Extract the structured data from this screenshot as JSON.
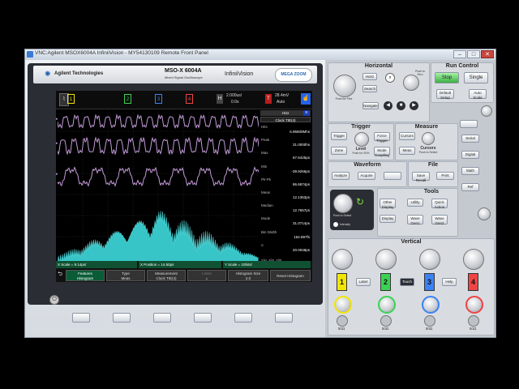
{
  "window": {
    "title": "VNC:Agilent MSOX6004A InfiniiVision - MY54130109 Remote Front Panel"
  },
  "brand": {
    "company": "Agilent Technologies",
    "model": "MSO-X 6004A",
    "model_sub": "Mixed Signal Oscilloscope",
    "series": "InfiniiVision",
    "mega": "MEGA ZOOM"
  },
  "screen": {
    "channels": [
      "1",
      "2",
      "3",
      "4"
    ],
    "channel_colors": [
      "#f2e600",
      "#39d353",
      "#3b82f6",
      "#ef4444"
    ],
    "timebase": {
      "scale": "2.000us/",
      "delay": "0.0s"
    },
    "trigger": {
      "mode": "Auto",
      "level": "28.4mV",
      "channel": "1"
    },
    "meas_panel": {
      "header": "Hist",
      "subheader": "Clock TIE(4)",
      "rows": [
        {
          "label": "Hits",
          "value": "6.95500Mhs"
        },
        {
          "label": "Peak",
          "value": "31.0000hs"
        },
        {
          "label": "Max",
          "value": "67.6425ps"
        },
        {
          "label": "Min",
          "value": "-39.9266ps"
        },
        {
          "label": "Pk-Pk",
          "value": "86.6874ps"
        },
        {
          "label": "Mean",
          "value": "12.1363ps"
        },
        {
          "label": "Median",
          "value": "12.7657ps"
        },
        {
          "label": "Mode",
          "value": "31.0714ps"
        },
        {
          "label": "Bin Width",
          "value": "162.897fs"
        },
        {
          "label": "σ",
          "value": "20.0048ps"
        }
      ],
      "sigma_row": [
        "±1σ",
        "±2σ",
        "±3σ"
      ],
      "sigma_vals": [
        "65.4%",
        "99.6%",
        "100%"
      ]
    },
    "histbar": {
      "x_scale": "X Scale = 9.14ps/",
      "x_position": "X Position = 14.50ps",
      "y_scale": "Y Scale = 10hits/"
    },
    "softkeys": [
      {
        "line1": "Features",
        "line2": "Histogram"
      },
      {
        "line1": "Type",
        "line2": "Meas"
      },
      {
        "line1": "Measurement",
        "line2": "Clock TIE(4)"
      },
      {
        "line1": "Limits",
        "line2": ""
      },
      {
        "line1": "Histogram Size",
        "line2": "2.0"
      },
      {
        "line1": "Reset Histogram",
        "line2": ""
      }
    ]
  },
  "panel": {
    "horizontal": {
      "title": "Horizontal",
      "horiz": "Horiz",
      "search": "Search",
      "navigate": "Navigate",
      "push_zero": "Push to Zero",
      "push_fine": "Push for Fine"
    },
    "run_control": {
      "title": "Run Control",
      "stop": "Stop",
      "single": "Single",
      "default": "Default Setup",
      "auto": "Auto Scale"
    },
    "trigger": {
      "title": "Trigger",
      "trigger": "Trigger",
      "force": "Force Trigger",
      "zone": "Zone",
      "level": "Level",
      "level_sub": "Push for 50%",
      "mode": "Mode Coupling"
    },
    "measure": {
      "title": "Measure",
      "cursors": "Cursors",
      "cursors_label": "Cursors",
      "cursors_sub": "Push to Select",
      "meas": "Meas"
    },
    "waveform": {
      "title": "Waveform",
      "analyze": "Analyze",
      "acquire": "Acquire",
      "intensity": "Intensity"
    },
    "file": {
      "title": "File",
      "save": "Save Recall",
      "print": "Print"
    },
    "tools": {
      "title": "Tools",
      "utility": "Utility",
      "quick": "Quick Action",
      "other": "Other Display",
      "display": "Display",
      "wavegen1": "Wave Gen1",
      "wavegen2": "Wave Gen2"
    },
    "entry": {
      "push_select": "Push to Select"
    },
    "side": {
      "serial": "Serial",
      "digital": "Digital",
      "math": "Math",
      "ref": "Ref"
    },
    "vertical": {
      "title": "Vertical",
      "label": "Label",
      "touch": "Touch",
      "help": "Help",
      "ohm": "50Ω"
    }
  }
}
